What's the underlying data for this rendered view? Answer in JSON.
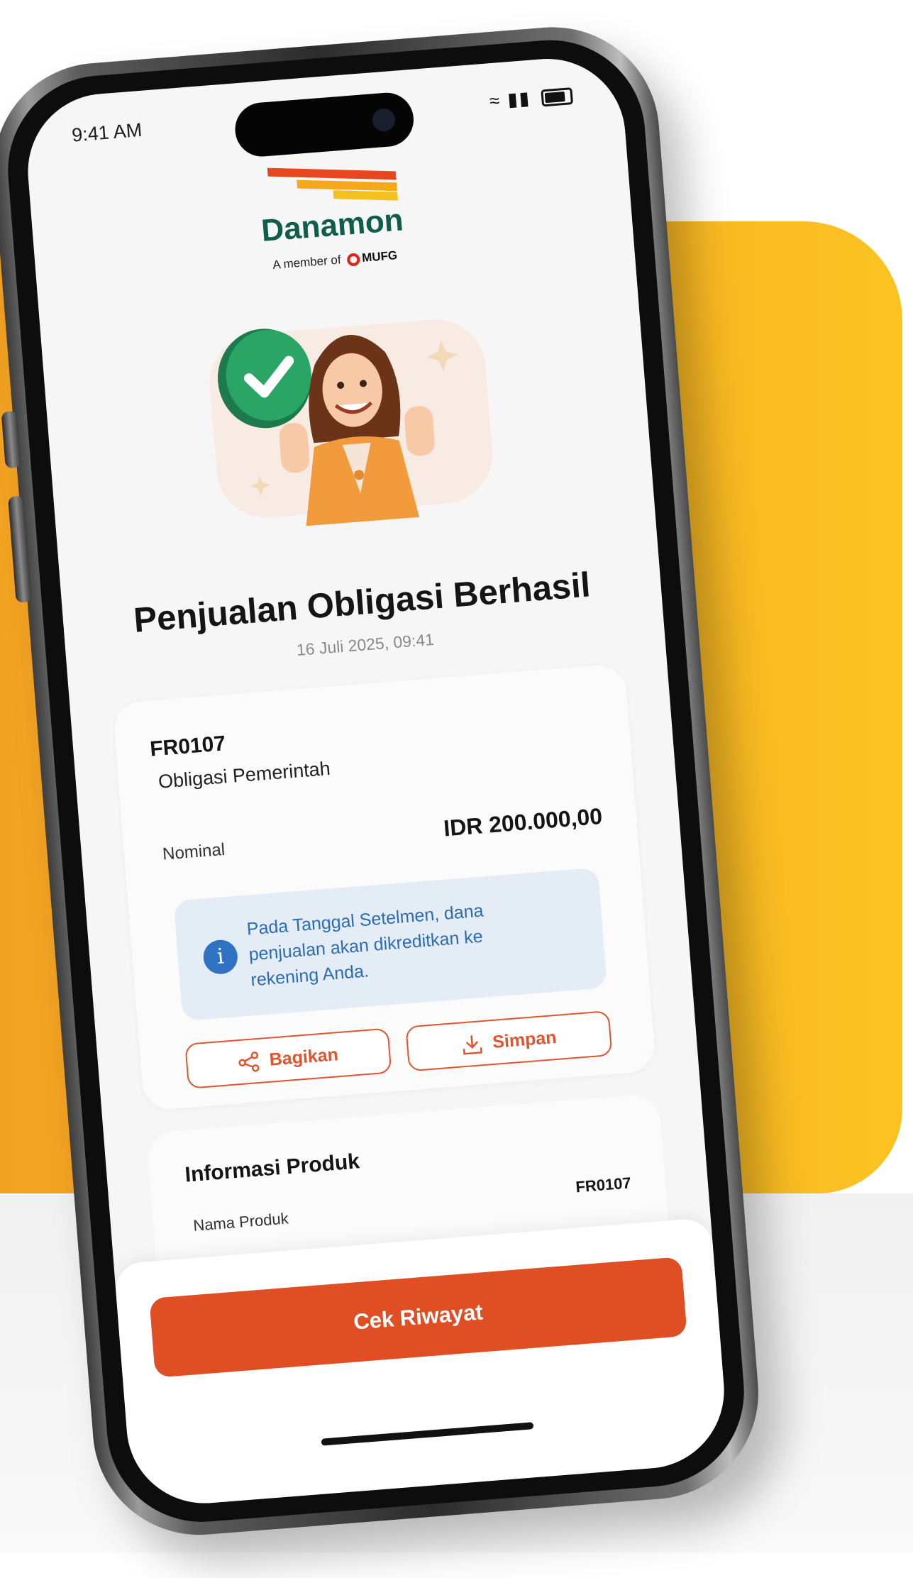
{
  "status_bar": {
    "time": "9:41 AM",
    "wifi": "wifi-icon",
    "signal": "signal-icon",
    "battery": "battery-icon"
  },
  "brand": {
    "name": "Danamon",
    "member_prefix": "A member of",
    "member_brand": "MUFG",
    "colors": {
      "green": "#0f5e4b",
      "red": "#e8461e",
      "orange": "#f6a81d"
    }
  },
  "result": {
    "title": "Penjualan Obligasi Berhasil",
    "datetime": "16 Juli 2025, 09:41"
  },
  "transaction": {
    "code": "FR0107",
    "product_type": "Obligasi Pemerintah",
    "nominal_label": "Nominal",
    "nominal_value": "IDR 200.000,00",
    "info_icon": "info-icon",
    "info_text": "Pada Tanggal Setelmen, dana penjualan akan dikreditkan ke rekening Anda.",
    "share_label": "Bagikan",
    "save_label": "Simpan"
  },
  "product_info": {
    "title": "Informasi Produk",
    "name_label": "Nama Produk",
    "name_value": "FR0107"
  },
  "cta": {
    "label": "Cek Riwayat",
    "color": "#e04e24"
  }
}
